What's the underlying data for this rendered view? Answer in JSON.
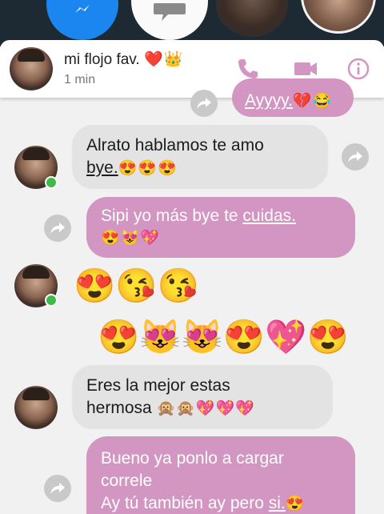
{
  "contact": {
    "name": "mi flojo fav.",
    "name_emojis": "❤️👑",
    "status": "1 min"
  },
  "header_icons": [
    "phone-icon",
    "video-camera-icon",
    "info-icon"
  ],
  "colors": {
    "accent": "#d395c2",
    "incoming_bubble": "#e3e3e3",
    "online": "#3fb94a"
  },
  "messages": [
    {
      "from": "me",
      "text": "Ayyyy.",
      "emojis": "💔😂",
      "partial": true
    },
    {
      "from": "them",
      "text_line1": "Alrato hablamos te amo",
      "link": "bye.",
      "emojis": "😍😍😍"
    },
    {
      "from": "me",
      "text": "Sipi yo más bye te ",
      "link": "cuidas.",
      "emojis": "😍😻💖"
    },
    {
      "from": "them",
      "emojis": "😍😘😘"
    },
    {
      "from": "me",
      "emojis": "😍😻😻😍💖😍"
    },
    {
      "from": "them",
      "text_line1": "Eres la mejor estas",
      "text_line2": "hermosa",
      "emojis": "🙊🙊💖💖💖"
    },
    {
      "from": "me",
      "text_line1": "Bueno ya ponlo a cargar",
      "text_line2": "correle",
      "text_line3": "Ay tú también ay pero ",
      "link": "si.",
      "emojis": "😍"
    }
  ]
}
